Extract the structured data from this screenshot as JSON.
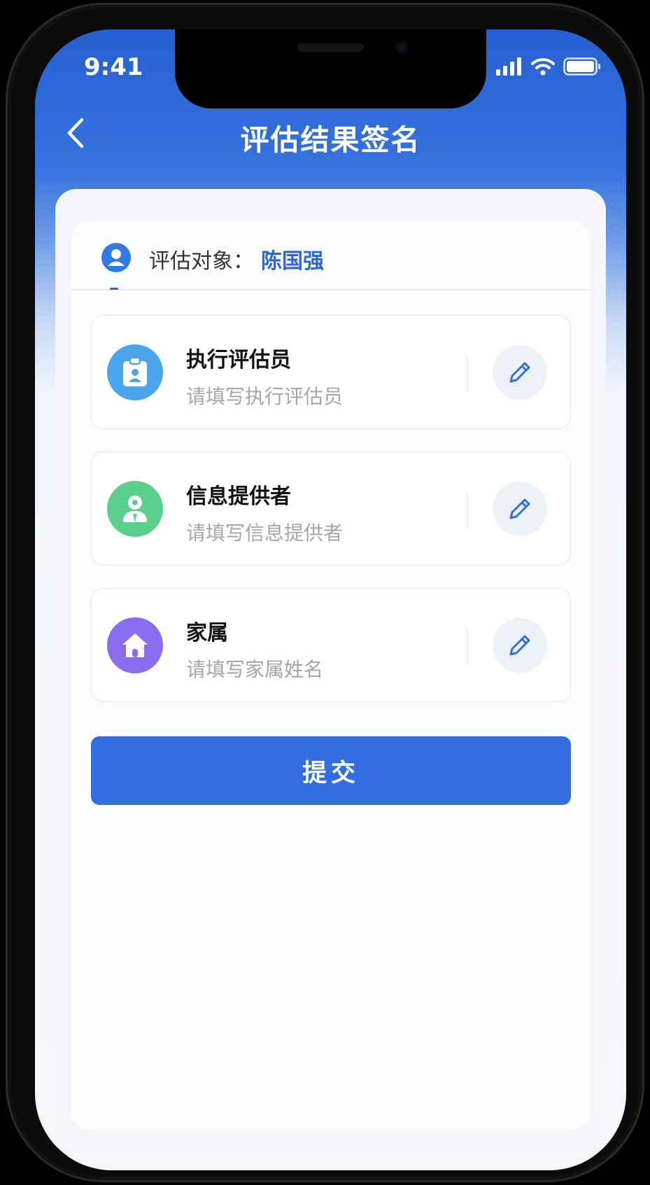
{
  "status_bar": {
    "time": "9:41"
  },
  "nav": {
    "title": "评估结果签名",
    "back_icon": "chevron-left-icon"
  },
  "subject": {
    "label": "评估对象：",
    "name": "陈国强",
    "icon": "user-circle-icon"
  },
  "signers": [
    {
      "title": "执行评估员",
      "placeholder": "请填写执行评估员",
      "icon": "clipboard-user-icon",
      "color": "#4aa5ec"
    },
    {
      "title": "信息提供者",
      "placeholder": "请填写信息提供者",
      "icon": "person-icon",
      "color": "#5bcf8c"
    },
    {
      "title": "家属",
      "placeholder": "请填写家属姓名",
      "icon": "home-icon",
      "color": "#8a6cf0"
    }
  ],
  "edit_icon": "pencil-icon",
  "submit": {
    "label": "提交"
  },
  "colors": {
    "primary": "#316fe0",
    "header": "#2660d2",
    "accent_text": "#2a67d8"
  }
}
